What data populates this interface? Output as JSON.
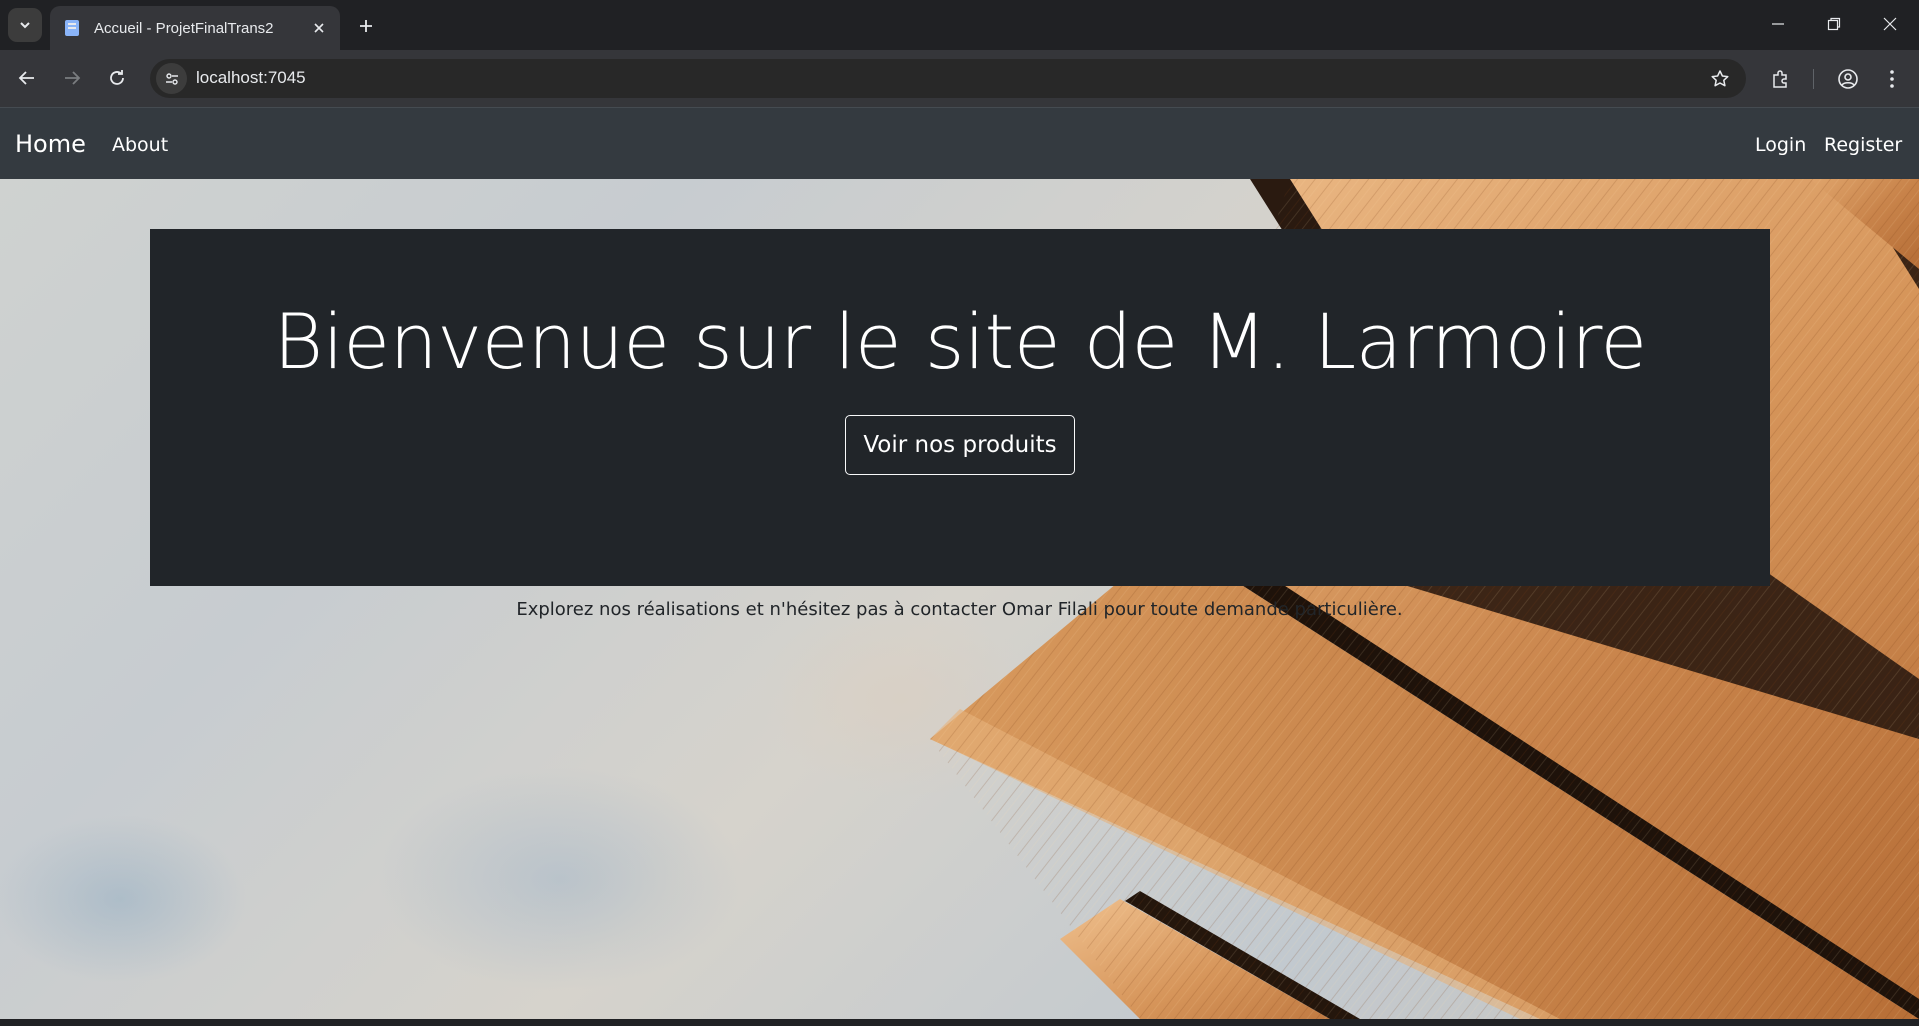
{
  "browser": {
    "tab_title": "Accueil - ProjetFinalTrans2",
    "url": "localhost:7045",
    "icons": [
      "tab-search-icon",
      "favicon-icon",
      "close-icon",
      "plus-icon",
      "minimize-icon",
      "restore-icon",
      "close-window-icon",
      "back-icon",
      "forward-icon",
      "reload-icon",
      "site-info-icon",
      "star-icon",
      "extensions-icon",
      "profile-icon",
      "menu-icon"
    ]
  },
  "nav": {
    "brand": "Home",
    "about": "About",
    "login": "Login",
    "register": "Register"
  },
  "hero": {
    "title": "Bienvenue sur le site de M. Larmoire",
    "button": "Voir nos produits",
    "lead": "Explorez nos réalisations et n'hésitez pas à contacter Omar Filali pour toute demande particulière."
  },
  "colors": {
    "navbar": "#343a40",
    "jumbotron": "#212529",
    "chrome": "#202124",
    "wood": "#c8834a"
  }
}
